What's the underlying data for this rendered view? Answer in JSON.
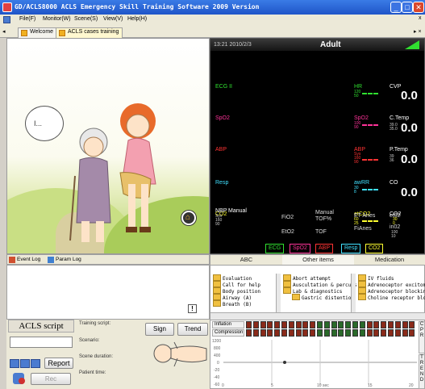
{
  "window": {
    "title": "GD/ACLS8000 ACLS Emergency Skill Training Software 2009 Version"
  },
  "menu": {
    "items": [
      "File(F)",
      "Monitor(W)",
      "Scene(S)",
      "View(V)",
      "Help(H)"
    ]
  },
  "tabs": [
    {
      "label": "Welcome",
      "active": false
    },
    {
      "label": "ACLS cases training",
      "active": true
    }
  ],
  "scene": {
    "speech_bubble": "I..."
  },
  "monitor": {
    "datetime": "13:21 2010/2/3",
    "patient_type": "Adult",
    "left_channels": [
      "ECG II",
      "SpO2",
      "ABP",
      "Resp",
      "CO2"
    ],
    "right_params": [
      {
        "label": "HR",
        "sub": "120\n50",
        "color": "#30e030"
      },
      {
        "label": "SpO2",
        "sub": "100\n90",
        "color": "#ff3399"
      },
      {
        "label": "ABP",
        "sub": "Sys\n160\n90",
        "color": "#ff3333"
      },
      {
        "label": "awRR",
        "sub": "30\n8",
        "color": "#40e0ff"
      },
      {
        "label": "etCO2",
        "sub": "60\n25",
        "color": "#ffff30"
      }
    ],
    "right_values": [
      {
        "label": "CVP",
        "sub": "",
        "value": "0.0"
      },
      {
        "label": "C.Temp",
        "sub": "39.0\n35.0",
        "value": "0.0"
      },
      {
        "label": "P.Temp",
        "sub": "39\n36",
        "value": "0.0"
      },
      {
        "label": "CO",
        "sub": "",
        "value": "0.0"
      },
      {
        "label": "CO2",
        "sub": "30\n0",
        "value": ""
      }
    ],
    "nbp": {
      "label": "NBP",
      "mode": "Manual",
      "sys_label": "Sys",
      "ranges": "160\n90"
    },
    "vent": {
      "fio2": "FiO2",
      "manual": "Manual",
      "tof_pct": "TOF%",
      "eto2": "EtO2",
      "tof": "TOF",
      "et_anes": "ET Anes",
      "et02": "et02",
      "fi_anes": "FiAnes",
      "in02": "in02",
      "in02_range": "100\n10"
    },
    "buttons": [
      {
        "label": "ECG",
        "color": "#30e030"
      },
      {
        "label": "SpO2",
        "color": "#ff3399"
      },
      {
        "label": "ABP",
        "color": "#ff3333"
      },
      {
        "label": "Resp",
        "color": "#40e0ff"
      },
      {
        "label": "CO2",
        "color": "#ffff30"
      }
    ]
  },
  "log_tabs": [
    "Event Log",
    "Param Log"
  ],
  "action_tabs": [
    "ABC",
    "Other items",
    "Medication"
  ],
  "action_lists": {
    "col1": [
      "Evaluation",
      "Call for help",
      "Body position",
      "Airway (A)",
      "Breath (B)"
    ],
    "col2": [
      "Abort attempt",
      "Auscultation & percuss",
      "Lab & diagnostics",
      "Gastric distention"
    ],
    "col3": [
      "IV fluids",
      "Adrenoceptor excitomot",
      "Adrenoceptor blockin",
      "Choline receptor block"
    ]
  },
  "ctrl": {
    "acls_script": "ACLS script",
    "training_script": "Training script:",
    "scenario": "Scenario:",
    "scene_duration": "Scene duration:",
    "patient_time": "Patient time:",
    "sign": "Sign",
    "trend": "Trend",
    "report": "Report",
    "rec": "Rec",
    "info_icon": "!"
  },
  "chart": {
    "inflation": "Inflation",
    "compression": "Compression",
    "y_ticks": [
      "1200",
      "800",
      "400",
      "0",
      "-20",
      "-40",
      "-60"
    ],
    "x_ticks": [
      "0",
      "5",
      "10 sec",
      "15",
      "20"
    ],
    "side_buttons": [
      "C P R",
      "T R E N D"
    ]
  }
}
